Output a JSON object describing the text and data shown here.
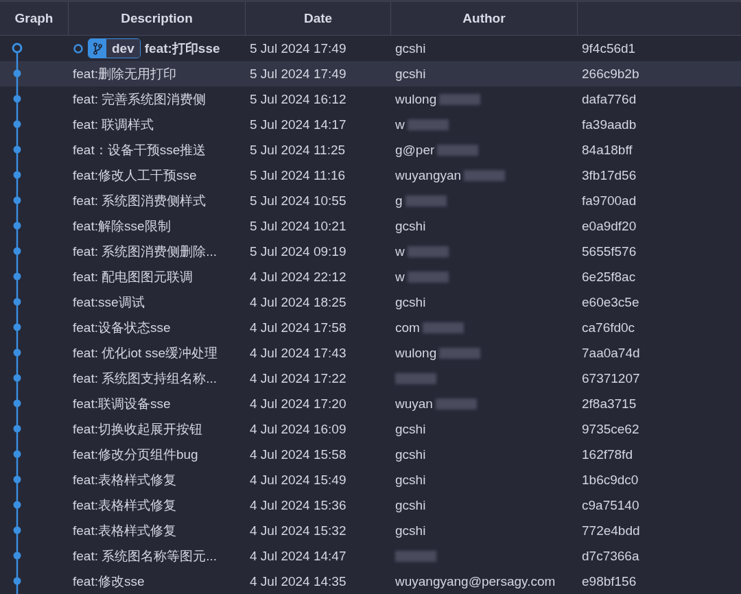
{
  "columns": [
    "Graph",
    "Description",
    "Date",
    "Author"
  ],
  "commits": [
    {
      "head": true,
      "branch": "dev",
      "description": "feat:打印sse",
      "date": "5 Jul 2024 17:49",
      "author": "gcshi",
      "hash": "9f4c56d1",
      "selected": false,
      "blurred": false
    },
    {
      "head": false,
      "description": "feat:删除无用打印",
      "date": "5 Jul 2024 17:49",
      "author": "gcshi",
      "hash": "266c9b2b",
      "selected": true,
      "blurred": false
    },
    {
      "head": false,
      "description": "feat: 完善系统图消费侧",
      "date": "5 Jul 2024 16:12",
      "author": "wulong",
      "hash": "dafa776d",
      "selected": false,
      "blurred": true
    },
    {
      "head": false,
      "description": "feat: 联调样式",
      "date": "5 Jul 2024 14:17",
      "author": "w",
      "hash": "fa39aadb",
      "selected": false,
      "blurred": true
    },
    {
      "head": false,
      "description": "feat：设备干预sse推送",
      "date": "5 Jul 2024 11:25",
      "author": "g@per",
      "hash": "84a18bff",
      "selected": false,
      "blurred": true
    },
    {
      "head": false,
      "description": "feat:修改人工干预sse",
      "date": "5 Jul 2024 11:16",
      "author": "wuyangyan",
      "hash": "3fb17d56",
      "selected": false,
      "blurred": true
    },
    {
      "head": false,
      "description": "feat: 系统图消费侧样式",
      "date": "5 Jul 2024 10:55",
      "author": "g",
      "hash": "fa9700ad",
      "selected": false,
      "blurred": true
    },
    {
      "head": false,
      "description": "feat:解除sse限制",
      "date": "5 Jul 2024 10:21",
      "author": "gcshi",
      "hash": "e0a9df20",
      "selected": false,
      "blurred": false
    },
    {
      "head": false,
      "description": "feat: 系统图消费侧删除...",
      "date": "5 Jul 2024 09:19",
      "author": "w",
      "hash": "5655f576",
      "selected": false,
      "blurred": true
    },
    {
      "head": false,
      "description": "feat: 配电图图元联调",
      "date": "4 Jul 2024 22:12",
      "author": "w",
      "hash": "6e25f8ac",
      "selected": false,
      "blurred": true
    },
    {
      "head": false,
      "description": "feat:sse调试",
      "date": "4 Jul 2024 18:25",
      "author": "gcshi",
      "hash": "e60e3c5e",
      "selected": false,
      "blurred": false
    },
    {
      "head": false,
      "description": "feat:设备状态sse",
      "date": "4 Jul 2024 17:58",
      "author": "com",
      "hash": "ca76fd0c",
      "selected": false,
      "blurred": true
    },
    {
      "head": false,
      "description": "feat: 优化iot sse缓冲处理",
      "date": "4 Jul 2024 17:43",
      "author": "wulong",
      "hash": "7aa0a74d",
      "selected": false,
      "blurred": true
    },
    {
      "head": false,
      "description": "feat: 系统图支持组名称...",
      "date": "4 Jul 2024 17:22",
      "hash": "67371207",
      "selected": false,
      "blurred": true
    },
    {
      "head": false,
      "description": "feat:联调设备sse",
      "date": "4 Jul 2024 17:20",
      "author": "wuyan",
      "hash": "2f8a3715",
      "selected": false,
      "blurred": true
    },
    {
      "head": false,
      "description": "feat:切换收起展开按钮",
      "date": "4 Jul 2024 16:09",
      "author": "gcshi",
      "hash": "9735ce62",
      "selected": false,
      "blurred": false
    },
    {
      "head": false,
      "description": "feat:修改分页组件bug",
      "date": "4 Jul 2024 15:58",
      "author": "gcshi",
      "hash": "162f78fd",
      "selected": false,
      "blurred": false
    },
    {
      "head": false,
      "description": "feat:表格样式修复",
      "date": "4 Jul 2024 15:49",
      "author": "gcshi",
      "hash": "1b6c9dc0",
      "selected": false,
      "blurred": false
    },
    {
      "head": false,
      "description": "feat:表格样式修复",
      "date": "4 Jul 2024 15:36",
      "author": "gcshi",
      "hash": "c9a75140",
      "selected": false,
      "blurred": false
    },
    {
      "head": false,
      "description": "feat:表格样式修复",
      "date": "4 Jul 2024 15:32",
      "author": "gcshi",
      "hash": "772e4bdd",
      "selected": false,
      "blurred": false
    },
    {
      "head": false,
      "description": "feat: 系统图名称等图元...",
      "date": "4 Jul 2024 14:47",
      "hash": "d7c7366a",
      "selected": false,
      "blurred": true
    },
    {
      "head": false,
      "description": "feat:修改sse",
      "date": "4 Jul 2024 14:35",
      "author": "wuyangyang@persagy.com",
      "hash": "e98bf156",
      "selected": false,
      "blurred": false
    }
  ]
}
